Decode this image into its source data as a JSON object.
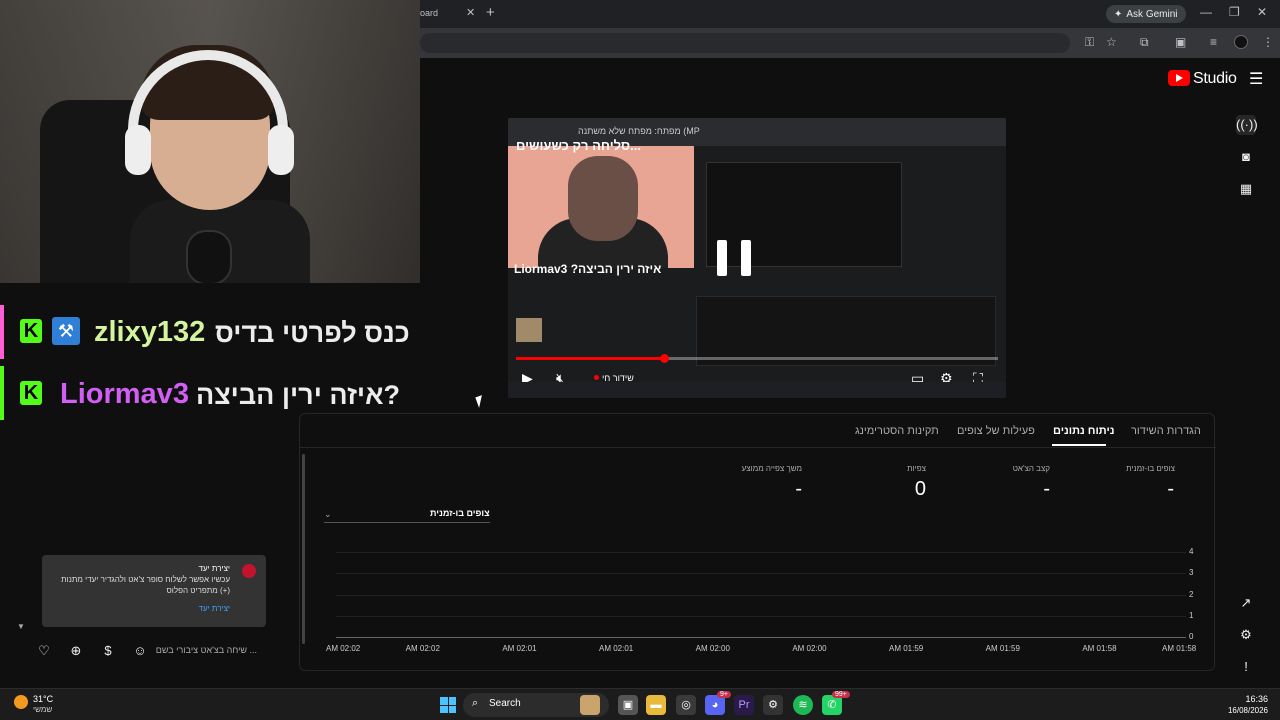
{
  "browser": {
    "tab_fragment": "oard",
    "ask_gemini": "Ask Gemini"
  },
  "studio": {
    "title": "Studio"
  },
  "overlay_chat": {
    "messages": [
      {
        "user": "zlixy132",
        "text": "כנס לפרטי בדיס",
        "user_color": "#d5f4a0",
        "bar_color": "#ff5dd6"
      },
      {
        "user": "Liormav3",
        "text": "איזה ירין הביצה?",
        "user_color": "#d25ff3",
        "bar_color": "#53fc18"
      }
    ]
  },
  "goal_card": {
    "title": "יצירת יעד",
    "body": "עכשיו אפשר לשלוח סופר צ'אט ולהגדיר יעדי מתנות מתפריט הפלוס (+)",
    "link": "יצירת יעד"
  },
  "composer": {
    "placeholder": "שיחה בצ'אט ציבורי בשם ..."
  },
  "player": {
    "search_text": "מפתח: מפתח שלא משתנה (MP",
    "banner_text": "סליחה רק כשעושים...",
    "chat_line": "Liormav3 ?איזה ירין הביצה",
    "live_label": "שידור חי"
  },
  "analytics": {
    "tabs": [
      {
        "label": "הגדרות השידור",
        "active": false
      },
      {
        "label": "ניתוח נתונים",
        "active": true
      },
      {
        "label": "פעילות של צופים",
        "active": false
      },
      {
        "label": "תקינות הסטרימינג",
        "active": false
      }
    ],
    "metrics": [
      {
        "label": "צופים בו-זמנית",
        "value": "-"
      },
      {
        "label": "קצב הצ'אט",
        "value": "-"
      },
      {
        "label": "צפיות",
        "value": "0"
      },
      {
        "label": "משך צפייה ממוצע",
        "value": "-"
      }
    ],
    "dropdown_label": "צופים בו-זמנית"
  },
  "chart_data": {
    "type": "line",
    "title": "",
    "xlabel": "",
    "ylabel": "",
    "x": [
      "AM 02:02",
      "AM 02:02",
      "AM 02:01",
      "AM 02:01",
      "AM 02:00",
      "AM 02:00",
      "AM 01:59",
      "AM 01:59",
      "AM 01:58",
      "AM 01:58"
    ],
    "y_ticks": [
      "4",
      "3",
      "2",
      "1",
      "0"
    ],
    "ylim": [
      0,
      4
    ],
    "series": [],
    "grid": true,
    "y_axis_position": "right"
  },
  "taskbar": {
    "temperature": "31°C",
    "condition": "שמשי",
    "search": "Search",
    "time": "16:36",
    "date": "16/08/2026",
    "badge_discord": "9+",
    "badge_whatsapp": "99+"
  },
  "colors": {
    "brand_red": "#ff0000",
    "kick_green": "#53fc18",
    "link_blue": "#3ea6ff"
  }
}
